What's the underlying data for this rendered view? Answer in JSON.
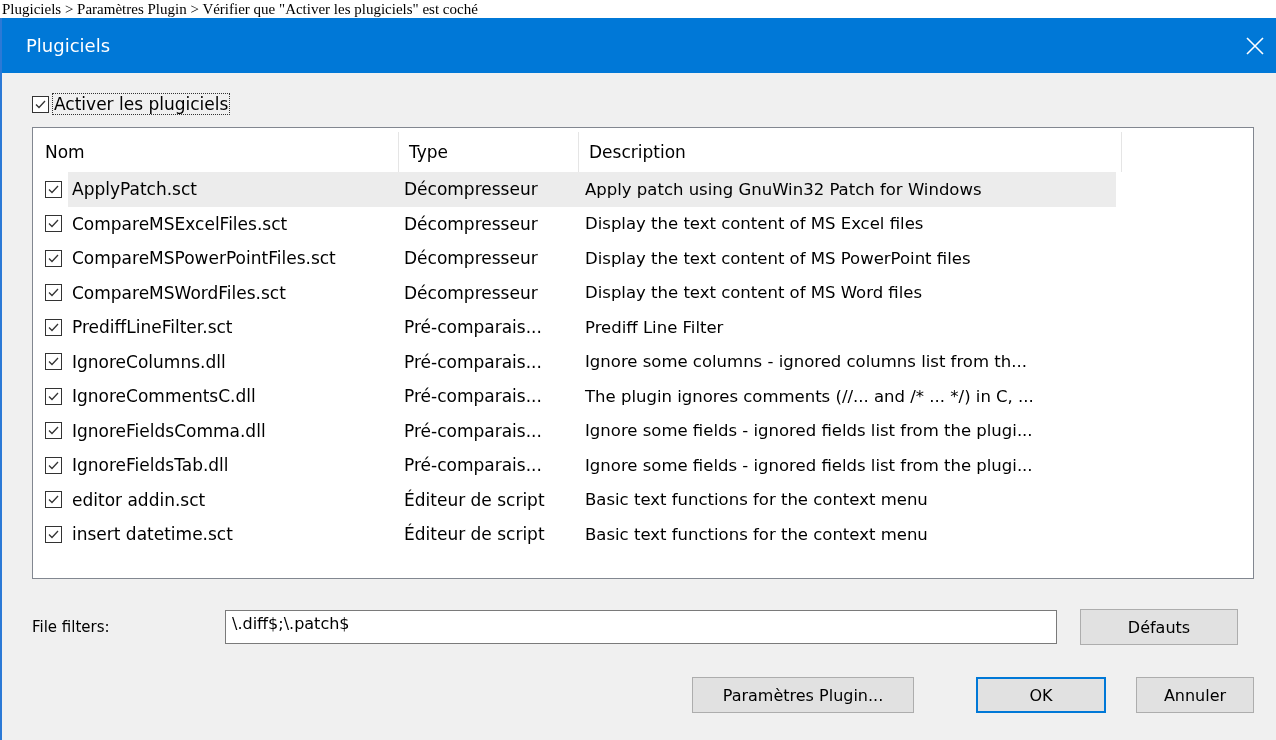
{
  "caption": "Plugiciels > Paramètres Plugin > Vérifier que \"Activer les plugiciels\" est coché",
  "window": {
    "title": "Plugiciels"
  },
  "enable": {
    "label": "Activer les plugiciels",
    "checked": true
  },
  "table": {
    "columns": [
      "Nom",
      "Type",
      "Description"
    ],
    "rows": [
      {
        "checked": true,
        "selected": true,
        "name": "ApplyPatch.sct",
        "type": "Décompresseur",
        "description": "Apply patch using GnuWin32 Patch for Windows"
      },
      {
        "checked": true,
        "selected": false,
        "name": "CompareMSExcelFiles.sct",
        "type": "Décompresseur",
        "description": "Display the text content of MS Excel files"
      },
      {
        "checked": true,
        "selected": false,
        "name": "CompareMSPowerPointFiles.sct",
        "type": "Décompresseur",
        "description": "Display the text content of MS PowerPoint files"
      },
      {
        "checked": true,
        "selected": false,
        "name": "CompareMSWordFiles.sct",
        "type": "Décompresseur",
        "description": "Display the text content of MS Word files"
      },
      {
        "checked": true,
        "selected": false,
        "name": "PrediffLineFilter.sct",
        "type": "Pré-comparais...",
        "description": "Prediff Line Filter"
      },
      {
        "checked": true,
        "selected": false,
        "name": "IgnoreColumns.dll",
        "type": "Pré-comparais...",
        "description": "Ignore some columns - ignored columns list from th..."
      },
      {
        "checked": true,
        "selected": false,
        "name": "IgnoreCommentsC.dll",
        "type": "Pré-comparais...",
        "description": "The plugin ignores comments (//... and /* ... */) in C, ..."
      },
      {
        "checked": true,
        "selected": false,
        "name": "IgnoreFieldsComma.dll",
        "type": "Pré-comparais...",
        "description": "Ignore some fields - ignored fields list from the plugi..."
      },
      {
        "checked": true,
        "selected": false,
        "name": "IgnoreFieldsTab.dll",
        "type": "Pré-comparais...",
        "description": "Ignore some fields - ignored fields list from the plugi..."
      },
      {
        "checked": true,
        "selected": false,
        "name": "editor addin.sct",
        "type": "Éditeur de script",
        "description": "Basic text functions for the context menu"
      },
      {
        "checked": true,
        "selected": false,
        "name": "insert datetime.sct",
        "type": "Éditeur de script",
        "description": "Basic text functions for the context menu"
      }
    ]
  },
  "file_filters": {
    "label": "File filters:",
    "value": "\\.diff$;\\.patch$"
  },
  "buttons": [
    {
      "label": "Défauts",
      "kind": "side"
    },
    {
      "label": "Paramètres Plugin...",
      "kind": "normal"
    },
    {
      "label": "OK",
      "kind": "default"
    },
    {
      "label": "Annuler",
      "kind": "normal"
    }
  ]
}
